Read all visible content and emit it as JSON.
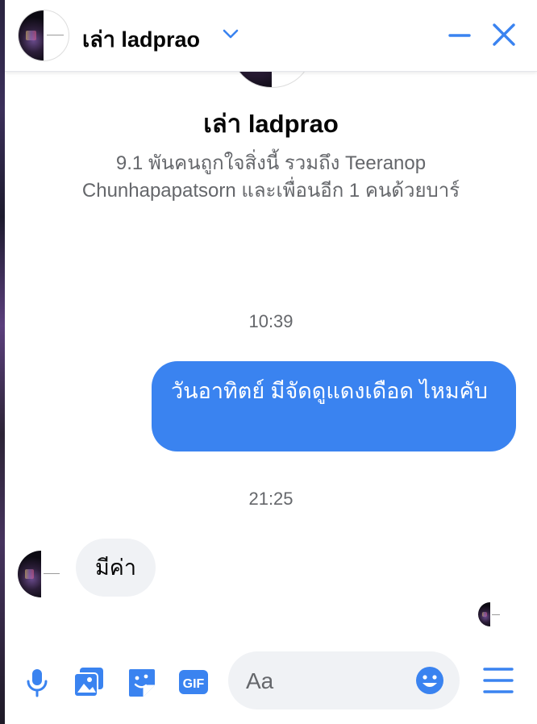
{
  "chat": {
    "title": "เล่า ladprao"
  },
  "profile": {
    "name": "เล่า ladprao",
    "info": "9.1 พันคนถูกใจสิ่งนี้ รวมถึง Teeranop Chunhapapatsorn และเพื่อนอีก 1 คนด้วยบาร์"
  },
  "messages": {
    "time_1": "10:39",
    "outgoing_1": "วันอาทิตย์  มีจัดดูแดงเดือด ไหมคับ",
    "time_2": "21:25",
    "incoming_1": "มีค่า"
  },
  "composer": {
    "placeholder": "Aa"
  },
  "icons": {
    "header": [
      "chevron-down-icon",
      "minimize-icon",
      "close-icon"
    ],
    "footer": [
      "microphone-icon",
      "photo-icon",
      "sticker-icon",
      "gif-icon",
      "emoji-icon",
      "menu-icon"
    ]
  },
  "colors": {
    "accent": "#3a83f0",
    "incoming_bubble": "#f0f2f5"
  }
}
